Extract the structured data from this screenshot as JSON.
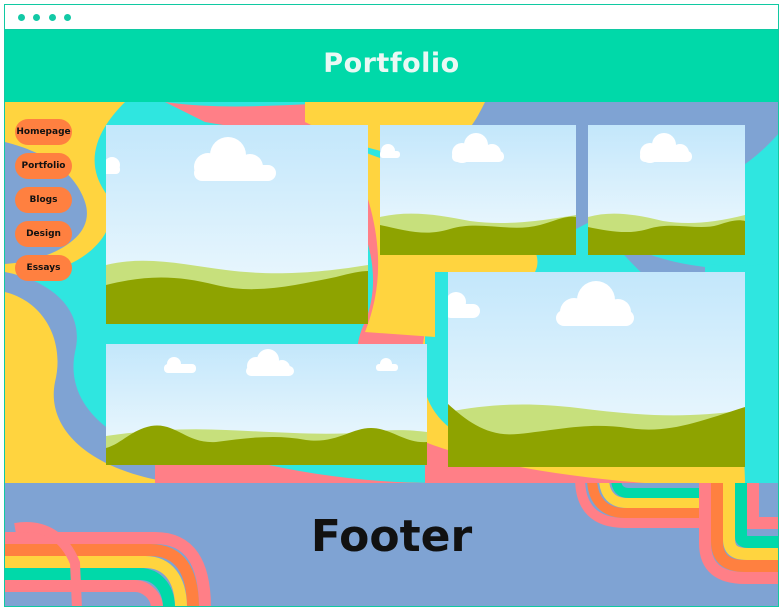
{
  "header": {
    "title": "Portfolio"
  },
  "nav": {
    "items": [
      {
        "label": "Homepage"
      },
      {
        "label": "Portfolio"
      },
      {
        "label": "Blogs"
      },
      {
        "label": "Design"
      },
      {
        "label": "Essays"
      }
    ]
  },
  "gallery": {
    "images": [
      "landscape-image",
      "landscape-image",
      "landscape-image",
      "landscape-image",
      "landscape-image"
    ]
  },
  "footer": {
    "text": "Footer"
  },
  "colors": {
    "header": "#00d9a9",
    "nav_button": "#ff8040",
    "content_bg_teal": "#2fe6e0",
    "blob_yellow": "#ffd43f",
    "blob_pink": "#ff7f87",
    "blob_blue": "#7fa3d3",
    "footer_bg": "#7fa3d3"
  }
}
